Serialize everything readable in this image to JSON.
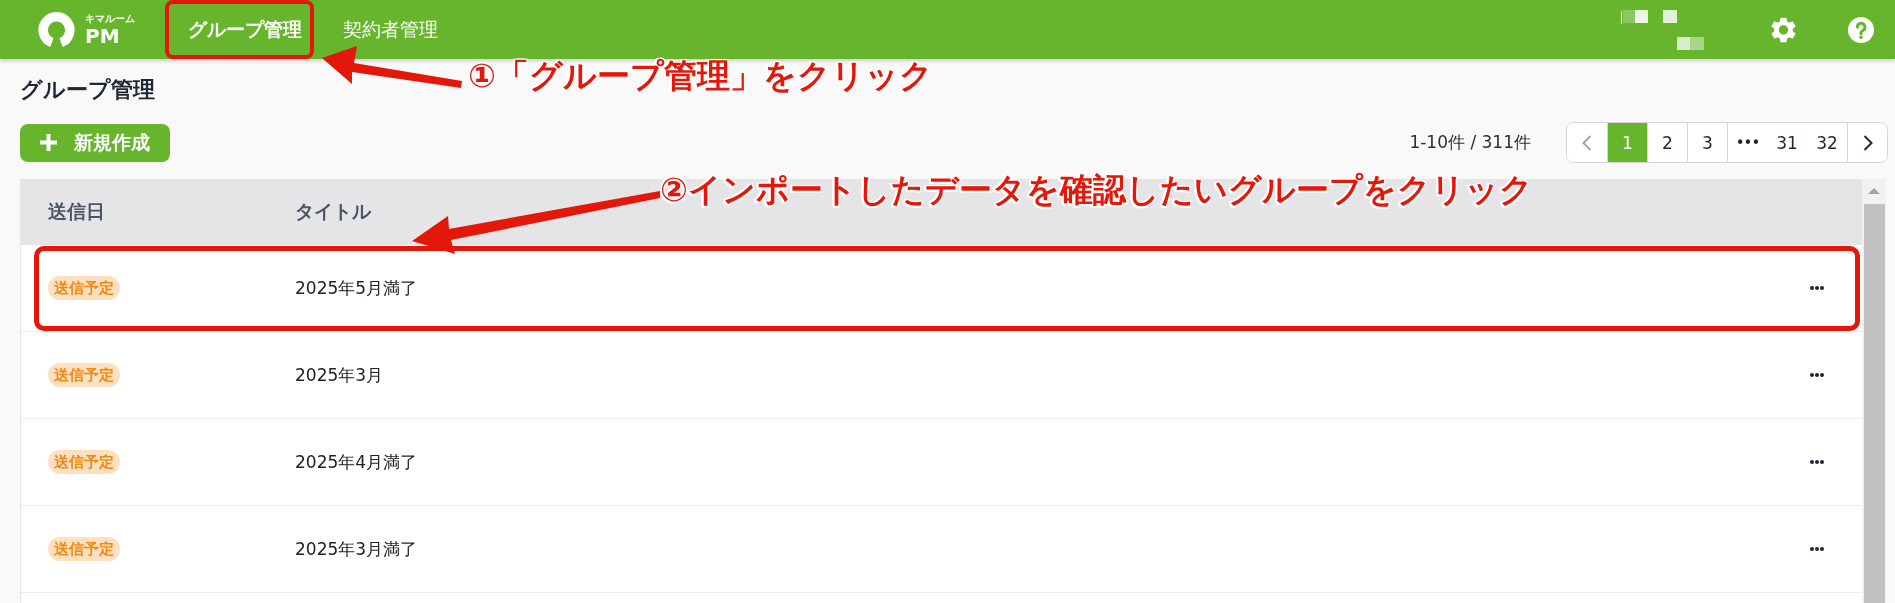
{
  "header": {
    "logo": {
      "caption": "キマルーム",
      "text": "PM"
    },
    "nav": [
      {
        "label": "グループ管理",
        "selected": true,
        "highlighted": true
      },
      {
        "label": "契約者管理",
        "selected": false,
        "highlighted": false
      }
    ]
  },
  "page": {
    "title": "グループ管理",
    "new_button": {
      "label": "新規作成"
    },
    "result_count": "1-10件 / 311件"
  },
  "pagination": {
    "items": [
      {
        "kind": "prev",
        "selected": false,
        "disabled": true
      },
      {
        "kind": "page",
        "label": "1",
        "selected": true,
        "disabled": false
      },
      {
        "kind": "page",
        "label": "2",
        "selected": false,
        "disabled": false
      },
      {
        "kind": "page",
        "label": "3",
        "selected": false,
        "disabled": false
      },
      {
        "kind": "ellipsis",
        "label": "•••",
        "selected": false,
        "disabled": false
      },
      {
        "kind": "page",
        "label": "31",
        "selected": false,
        "disabled": false
      },
      {
        "kind": "page",
        "label": "32",
        "selected": false,
        "disabled": false
      },
      {
        "kind": "next",
        "selected": false,
        "disabled": false
      }
    ]
  },
  "table": {
    "columns": [
      "送信日",
      "タイトル"
    ],
    "rows": [
      {
        "status": "送信予定",
        "title": "2025年5月満了",
        "highlighted": true
      },
      {
        "status": "送信予定",
        "title": "2025年3月",
        "highlighted": false
      },
      {
        "status": "送信予定",
        "title": "2025年4月満了",
        "highlighted": false
      },
      {
        "status": "送信予定",
        "title": "2025年3月満了",
        "highlighted": false
      }
    ]
  },
  "callouts": [
    {
      "text": "①「グループ管理」をクリック"
    },
    {
      "text": "②インポートしたデータを確認したいグループをクリック"
    }
  ]
}
